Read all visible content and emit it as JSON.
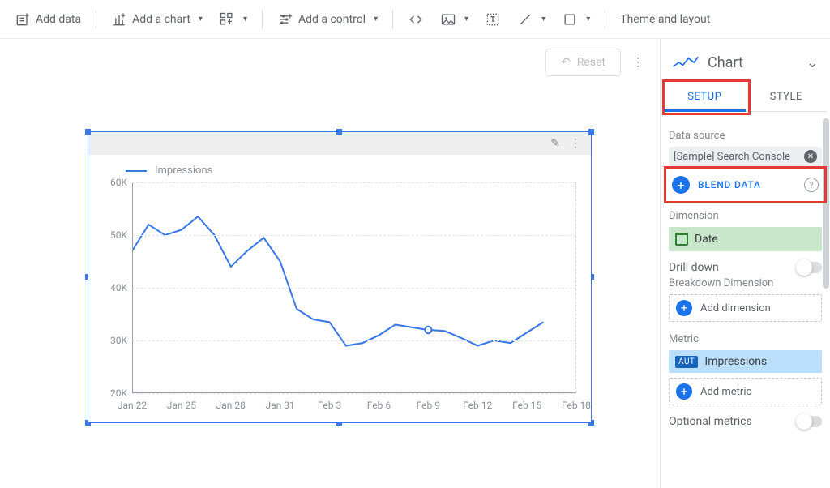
{
  "toolbar": {
    "add_data": "Add data",
    "add_chart": "Add a chart",
    "add_control": "Add a control",
    "theme_layout": "Theme and layout"
  },
  "reset_label": "Reset",
  "chart_data": {
    "type": "line",
    "title": "",
    "legend": [
      "Impressions"
    ],
    "ylabel": "",
    "xlabel": "",
    "ylim": [
      20000,
      60000
    ],
    "yticks": [
      "60K",
      "50K",
      "40K",
      "30K",
      "20K"
    ],
    "xticks": [
      "Jan 22",
      "Jan 25",
      "Jan 28",
      "Jan 31",
      "Feb 3",
      "Feb 6",
      "Feb 9",
      "Feb 12",
      "Feb 15",
      "Feb 18"
    ],
    "x": [
      "Jan 22",
      "Jan 23",
      "Jan 24",
      "Jan 25",
      "Jan 26",
      "Jan 27",
      "Jan 28",
      "Jan 29",
      "Jan 30",
      "Jan 31",
      "Feb 1",
      "Feb 2",
      "Feb 3",
      "Feb 4",
      "Feb 5",
      "Feb 6",
      "Feb 7",
      "Feb 8",
      "Feb 9",
      "Feb 10",
      "Feb 11",
      "Feb 12",
      "Feb 13",
      "Feb 14",
      "Feb 15",
      "Feb 16"
    ],
    "series": [
      {
        "name": "Impressions",
        "values": [
          47000,
          52000,
          50000,
          51000,
          53500,
          50000,
          44000,
          47000,
          49500,
          45000,
          36000,
          34000,
          33500,
          29000,
          29500,
          31000,
          33000,
          32500,
          32000,
          31800,
          30500,
          29000,
          30000,
          29500,
          31500,
          33500
        ]
      }
    ],
    "highlight_index": 18
  },
  "panel": {
    "chart_label": "Chart",
    "tabs": {
      "setup": "SETUP",
      "style": "STYLE"
    },
    "data_source_label": "Data source",
    "data_source_value": "[Sample] Search Console",
    "blend_label": "BLEND DATA",
    "dimension_label": "Dimension",
    "dimension_value": "Date",
    "drill_label": "Drill down",
    "breakdown_label": "Breakdown Dimension",
    "add_dimension": "Add dimension",
    "metric_label": "Metric",
    "metric_badge": "AUT",
    "metric_value": "Impressions",
    "add_metric": "Add metric",
    "optional_metrics": "Optional metrics"
  }
}
